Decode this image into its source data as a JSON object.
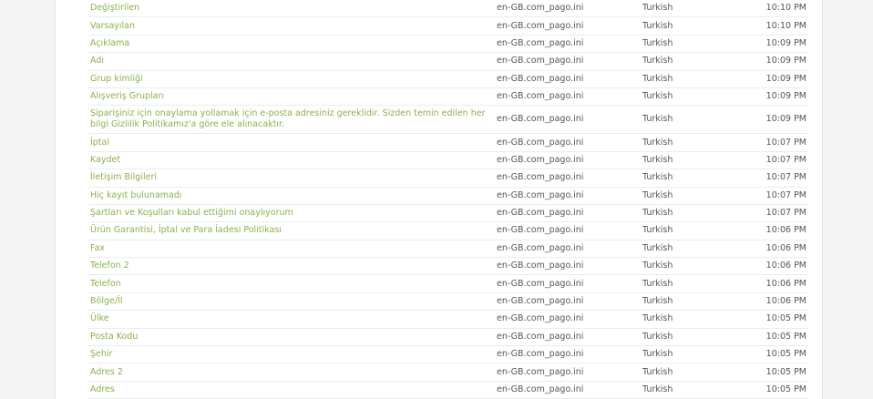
{
  "rows": [
    {
      "string": "Değiştirilen",
      "file": "en-GB.com_pago.ini",
      "language": "Turkish",
      "time": "10:10 PM"
    },
    {
      "string": "Varsayılan",
      "file": "en-GB.com_pago.ini",
      "language": "Turkish",
      "time": "10:10 PM"
    },
    {
      "string": "Açıklama",
      "file": "en-GB.com_pago.ini",
      "language": "Turkish",
      "time": "10:09 PM"
    },
    {
      "string": "Adı",
      "file": "en-GB.com_pago.ini",
      "language": "Turkish",
      "time": "10:09 PM"
    },
    {
      "string": "Grup kimliği",
      "file": "en-GB.com_pago.ini",
      "language": "Turkish",
      "time": "10:09 PM"
    },
    {
      "string": "Alışveriş Grupları",
      "file": "en-GB.com_pago.ini",
      "language": "Turkish",
      "time": "10:09 PM"
    },
    {
      "string": "Siparişiniz için onaylama yollamak için e-posta adresiniz gereklidir. Sizden temin edilen her bilgi Gizlilik Politikamız'a göre ele alınacaktır.",
      "file": "en-GB.com_pago.ini",
      "language": "Turkish",
      "time": "10:09 PM",
      "tall": true
    },
    {
      "string": "İptal",
      "file": "en-GB.com_pago.ini",
      "language": "Turkish",
      "time": "10:07 PM"
    },
    {
      "string": "Kaydet",
      "file": "en-GB.com_pago.ini",
      "language": "Turkish",
      "time": "10:07 PM"
    },
    {
      "string": "İletişim Bilgileri",
      "file": "en-GB.com_pago.ini",
      "language": "Turkish",
      "time": "10:07 PM"
    },
    {
      "string": "Hiç kayıt bulunamadı",
      "file": "en-GB.com_pago.ini",
      "language": "Turkish",
      "time": "10:07 PM"
    },
    {
      "string": "Şartları ve Koşulları kabul ettiğimi onaylıyorum",
      "file": "en-GB.com_pago.ini",
      "language": "Turkish",
      "time": "10:07 PM"
    },
    {
      "string": "Ürün Garantisi, İptal ve Para İadesi Politikası",
      "file": "en-GB.com_pago.ini",
      "language": "Turkish",
      "time": "10:06 PM"
    },
    {
      "string": "Fax",
      "file": "en-GB.com_pago.ini",
      "language": "Turkish",
      "time": "10:06 PM"
    },
    {
      "string": "Telefon 2",
      "file": "en-GB.com_pago.ini",
      "language": "Turkish",
      "time": "10:06 PM"
    },
    {
      "string": "Telefon",
      "file": "en-GB.com_pago.ini",
      "language": "Turkish",
      "time": "10:06 PM"
    },
    {
      "string": "Bölge/İl",
      "file": "en-GB.com_pago.ini",
      "language": "Turkish",
      "time": "10:06 PM"
    },
    {
      "string": "Ülke",
      "file": "en-GB.com_pago.ini",
      "language": "Turkish",
      "time": "10:05 PM"
    },
    {
      "string": "Posta Kodu",
      "file": "en-GB.com_pago.ini",
      "language": "Turkish",
      "time": "10:05 PM"
    },
    {
      "string": "Şehir",
      "file": "en-GB.com_pago.ini",
      "language": "Turkish",
      "time": "10:05 PM"
    },
    {
      "string": "Adres 2",
      "file": "en-GB.com_pago.ini",
      "language": "Turkish",
      "time": "10:05 PM"
    },
    {
      "string": "Adres",
      "file": "en-GB.com_pago.ini",
      "language": "Turkish",
      "time": "10:05 PM"
    }
  ],
  "colors": {
    "link": "#8bb04f",
    "text": "#555555",
    "divider": "#ececec",
    "background": "#f4f4f4",
    "panel": "#ffffff"
  }
}
